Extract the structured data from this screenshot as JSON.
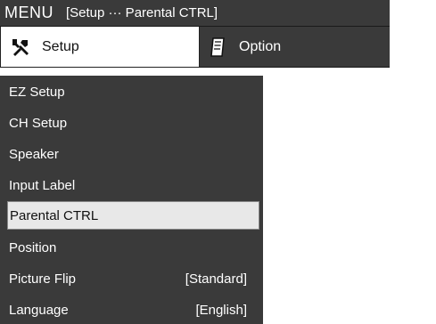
{
  "header": {
    "title": "MENU",
    "breadcrumb": "[Setup ··· Parental CTRL]"
  },
  "tabs": [
    {
      "label": "Setup",
      "icon": "wrench-icon",
      "active": true
    },
    {
      "label": "Option",
      "icon": "note-icon",
      "active": false
    }
  ],
  "menu_items": [
    {
      "label": "EZ Setup",
      "value": ""
    },
    {
      "label": "CH Setup",
      "value": ""
    },
    {
      "label": "Speaker",
      "value": ""
    },
    {
      "label": "Input Label",
      "value": ""
    },
    {
      "label": "Parental CTRL",
      "value": "",
      "selected": true
    },
    {
      "label": "Position",
      "value": ""
    },
    {
      "label": "Picture Flip",
      "value": "[Standard]"
    },
    {
      "label": "Language",
      "value": "[English]"
    }
  ],
  "colors": {
    "bar": "#3a3a3a",
    "selected": "#e8e8e8"
  }
}
